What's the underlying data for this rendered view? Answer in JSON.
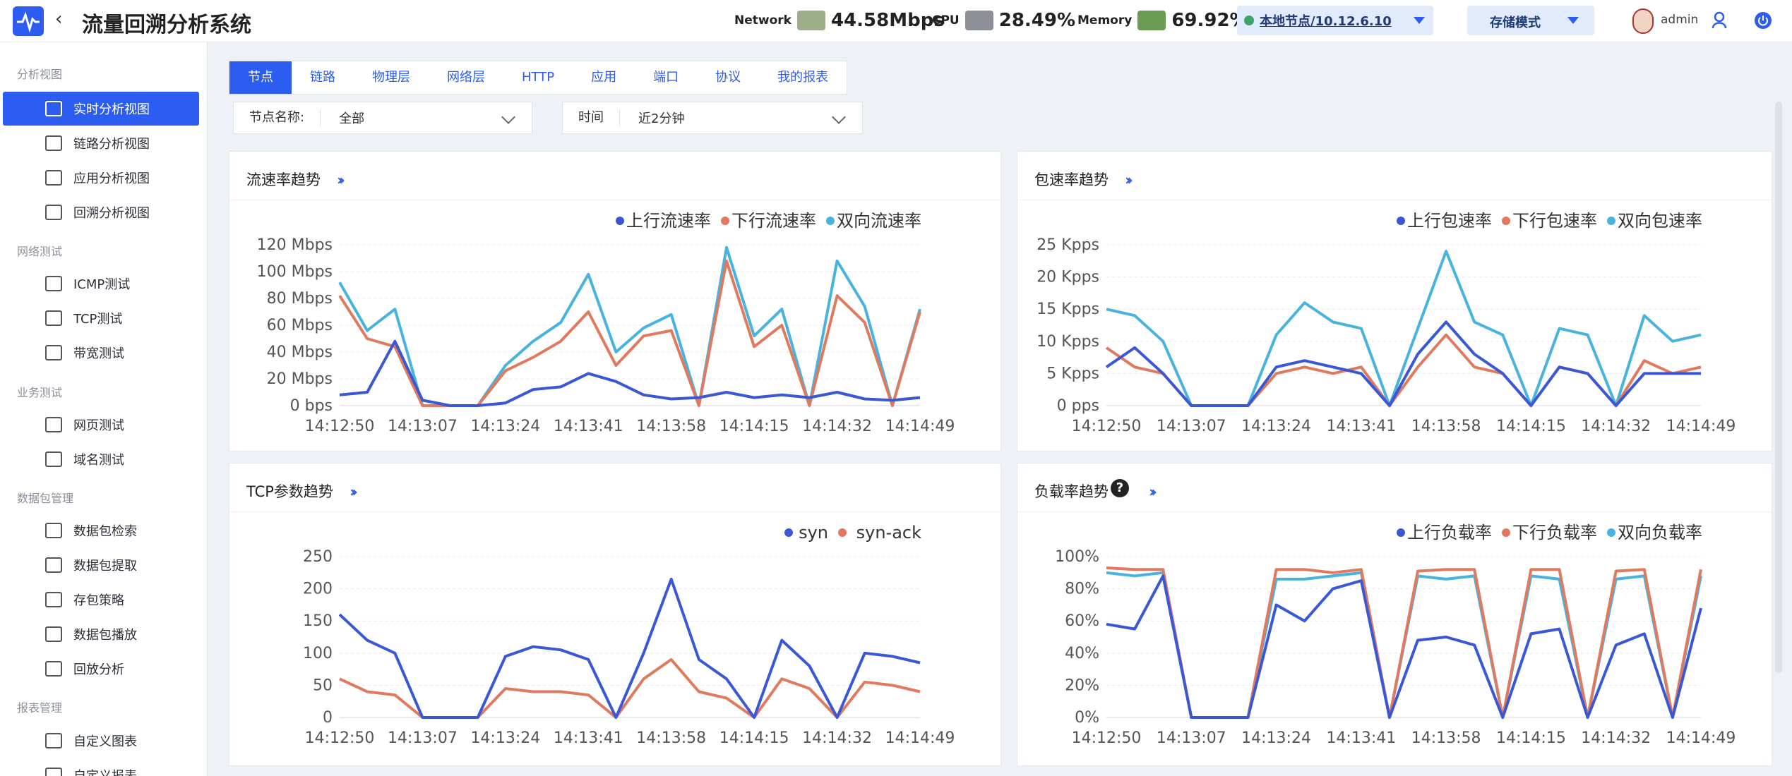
{
  "header": {
    "title": "流量回溯分析系统",
    "network_label": "Network",
    "network_value": "44.58Mbps",
    "cpu_label": "CPU",
    "cpu_value": "28.49%",
    "memory_label": "Memory",
    "memory_value": "69.92%",
    "node_select": "本地节点/10.12.6.10",
    "mode_select": "存储模式",
    "user": "admin"
  },
  "sidebar": {
    "sections": [
      {
        "title": "分析视图",
        "items": [
          "实时分析视图",
          "链路分析视图",
          "应用分析视图",
          "回溯分析视图"
        ]
      },
      {
        "title": "网络测试",
        "items": [
          "ICMP测试",
          "TCP测试",
          "带宽测试"
        ]
      },
      {
        "title": "业务测试",
        "items": [
          "网页测试",
          "域名测试"
        ]
      },
      {
        "title": "数据包管理",
        "items": [
          "数据包检索",
          "数据包提取",
          "存包策略",
          "数据包播放",
          "回放分析"
        ]
      },
      {
        "title": "报表管理",
        "items": [
          "自定义图表",
          "自定义报表"
        ]
      }
    ],
    "active": "实时分析视图"
  },
  "tabs": [
    "节点",
    "链路",
    "物理层",
    "网络层",
    "HTTP",
    "应用",
    "端口",
    "协议",
    "我的报表"
  ],
  "active_tab": "节点",
  "filters": {
    "node_label": "节点名称:",
    "node_value": "全部",
    "time_label": "时间",
    "time_value": "近2分钟"
  },
  "colors": {
    "blue": "#3a57d6",
    "orange": "#e07a5f",
    "cyan": "#49b3df",
    "accent": "#2d5df0"
  },
  "chart_data": [
    {
      "type": "line",
      "title": "流速率趋势",
      "x": [
        "14:12:50",
        "14:13:07",
        "14:13:24",
        "14:13:41",
        "14:13:58",
        "14:14:15",
        "14:14:32",
        "14:14:49"
      ],
      "y_ticks": [
        "0 bps",
        "20 Mbps",
        "40 Mbps",
        "60 Mbps",
        "80 Mbps",
        "100 Mbps",
        "120 Mbps"
      ],
      "ylim": [
        0,
        120
      ],
      "legend": "top-right",
      "series": [
        {
          "name": "上行流速率",
          "color": "#3a57d6",
          "values": [
            8,
            10,
            48,
            4,
            0,
            0,
            2,
            12,
            14,
            24,
            18,
            8,
            5,
            6,
            10,
            6,
            8,
            6,
            10,
            5,
            4,
            6
          ]
        },
        {
          "name": "下行流速率",
          "color": "#e07a5f",
          "values": [
            82,
            50,
            44,
            0,
            0,
            0,
            26,
            36,
            48,
            70,
            30,
            52,
            56,
            0,
            108,
            44,
            60,
            0,
            82,
            62,
            0,
            70
          ]
        },
        {
          "name": "双向流速率",
          "color": "#49b3df",
          "values": [
            92,
            56,
            72,
            0,
            0,
            0,
            30,
            48,
            62,
            98,
            40,
            58,
            68,
            0,
            118,
            52,
            72,
            0,
            108,
            74,
            0,
            72
          ]
        }
      ]
    },
    {
      "type": "line",
      "title": "包速率趋势",
      "x": [
        "14:12:50",
        "14:13:07",
        "14:13:24",
        "14:13:41",
        "14:13:58",
        "14:14:15",
        "14:14:32",
        "14:14:49"
      ],
      "y_ticks": [
        "0 pps",
        "5 Kpps",
        "10 Kpps",
        "15 Kpps",
        "20 Kpps",
        "25 Kpps"
      ],
      "ylim": [
        0,
        25
      ],
      "legend": "top-right",
      "series": [
        {
          "name": "上行包速率",
          "color": "#3a57d6",
          "values": [
            6,
            9,
            5,
            0,
            0,
            0,
            6,
            7,
            6,
            5,
            0,
            8,
            13,
            8,
            5,
            0,
            6,
            5,
            0,
            5,
            5,
            5
          ]
        },
        {
          "name": "下行包速率",
          "color": "#e07a5f",
          "values": [
            9,
            6,
            5,
            0,
            0,
            0,
            5,
            6,
            5,
            6,
            0,
            6,
            11,
            6,
            5,
            0,
            6,
            5,
            0,
            7,
            5,
            6
          ]
        },
        {
          "name": "双向包速率",
          "color": "#49b3df",
          "values": [
            15,
            14,
            10,
            0,
            0,
            0,
            11,
            16,
            13,
            12,
            0,
            12,
            24,
            13,
            11,
            0,
            12,
            11,
            0,
            14,
            10,
            11
          ]
        }
      ]
    },
    {
      "type": "line",
      "title": "TCP参数趋势",
      "x": [
        "14:12:50",
        "14:13:07",
        "14:13:24",
        "14:13:41",
        "14:13:58",
        "14:14:15",
        "14:14:32",
        "14:14:49"
      ],
      "y_ticks": [
        "0",
        "50",
        "100",
        "150",
        "200",
        "250"
      ],
      "ylim": [
        0,
        250
      ],
      "legend": "top-right",
      "series": [
        {
          "name": "syn",
          "color": "#3a57d6",
          "values": [
            160,
            120,
            100,
            0,
            0,
            0,
            95,
            110,
            105,
            90,
            0,
            100,
            215,
            90,
            60,
            0,
            120,
            80,
            0,
            100,
            95,
            85
          ]
        },
        {
          "name": "syn-ack",
          "color": "#e07a5f",
          "values": [
            60,
            40,
            35,
            0,
            0,
            0,
            45,
            40,
            40,
            35,
            0,
            60,
            90,
            40,
            30,
            0,
            60,
            45,
            0,
            55,
            50,
            40
          ]
        }
      ]
    },
    {
      "type": "line",
      "title": "负载率趋势",
      "x": [
        "14:12:50",
        "14:13:07",
        "14:13:24",
        "14:13:41",
        "14:13:58",
        "14:14:15",
        "14:14:32",
        "14:14:49"
      ],
      "y_ticks": [
        "0%",
        "20%",
        "40%",
        "60%",
        "80%",
        "100%"
      ],
      "ylim": [
        0,
        100
      ],
      "legend": "top-right",
      "series": [
        {
          "name": "上行负载率",
          "color": "#3a57d6",
          "values": [
            58,
            55,
            88,
            0,
            0,
            0,
            70,
            60,
            80,
            85,
            0,
            48,
            50,
            45,
            0,
            52,
            55,
            0,
            45,
            52,
            0,
            68
          ]
        },
        {
          "name": "下行负载率",
          "color": "#e07a5f",
          "values": [
            93,
            92,
            92,
            0,
            0,
            0,
            92,
            92,
            90,
            92,
            0,
            91,
            92,
            92,
            0,
            92,
            92,
            0,
            91,
            92,
            0,
            92
          ]
        },
        {
          "name": "双向负载率",
          "color": "#49b3df",
          "values": [
            90,
            88,
            90,
            0,
            0,
            0,
            86,
            86,
            88,
            90,
            0,
            88,
            86,
            88,
            0,
            88,
            86,
            0,
            86,
            88,
            0,
            88
          ]
        }
      ]
    }
  ]
}
